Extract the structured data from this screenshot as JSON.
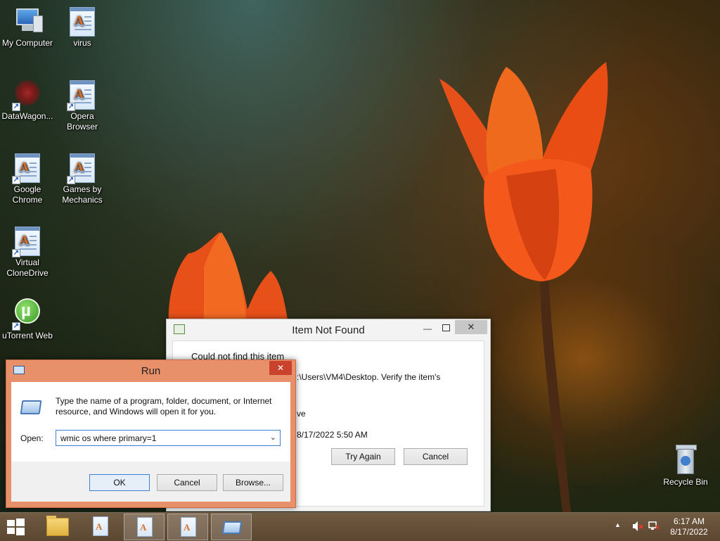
{
  "desktop_icons": [
    {
      "label": "My Computer",
      "icon": "computer-icon"
    },
    {
      "label": "virus",
      "icon": "document-icon"
    },
    {
      "label": "DataWagon...",
      "icon": "datawagon-icon"
    },
    {
      "label": "Opera Browser",
      "icon": "document-icon"
    },
    {
      "label": "Google Chrome",
      "icon": "document-icon"
    },
    {
      "label": "Games by Mechanics",
      "icon": "document-icon"
    },
    {
      "label": "Virtual CloneDrive",
      "icon": "document-icon"
    },
    {
      "label": "uTorrent Web",
      "icon": "utorrent-icon"
    },
    {
      "label": "Recycle Bin",
      "icon": "recycle-bin-icon"
    }
  ],
  "item_not_found": {
    "title": "Item Not Found",
    "message_line1": "Could not find this item",
    "message_line2": ":\\Users\\VM4\\Desktop. Verify the item's",
    "message_line3": "ve",
    "date": "8/17/2022 5:50 AM",
    "try_again": "Try Again",
    "cancel": "Cancel"
  },
  "run_dialog": {
    "title": "Run",
    "description": "Type the name of a program, folder, document, or Internet resource, and Windows will open it for you.",
    "open_label": "Open:",
    "input_value": "wmic os where primary=1",
    "ok": "OK",
    "cancel": "Cancel",
    "browse": "Browse..."
  },
  "taskbar": {
    "time": "6:17 AM",
    "date": "8/17/2022",
    "colors": {
      "run_border": "#d9805a",
      "accent": "#3c7fd4"
    }
  }
}
